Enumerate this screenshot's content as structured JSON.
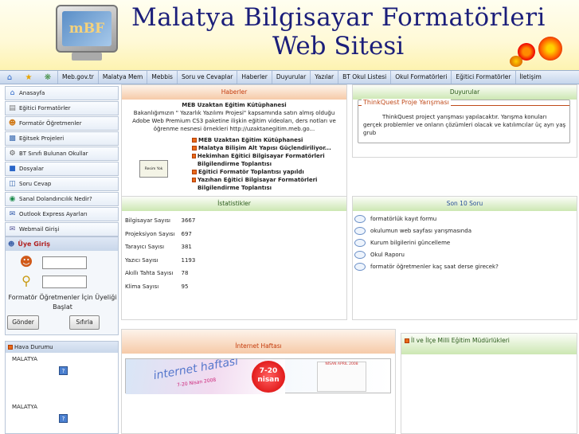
{
  "header": {
    "logo_text": "mBF",
    "title_line1": "Malatya Bilgisayar Formatörleri",
    "title_line2": "Web Sitesi"
  },
  "nav": {
    "icons": [
      "home-icon",
      "favorite-star-icon",
      "network-icon"
    ],
    "items": [
      "Meb.gov.tr",
      "Malatya Mem",
      "Mebbis",
      "Soru ve Cevaplar",
      "Haberler",
      "Duyurular",
      "Yazılar",
      "BT Okul Listesi",
      "Okul Formatörleri",
      "Eğitici Formatörler",
      "İletişim"
    ]
  },
  "sidebar": {
    "items": [
      {
        "label": "Anasayfa",
        "icon": "home-icon"
      },
      {
        "label": "Eğitici Formatörler",
        "icon": "document-icon"
      },
      {
        "label": "Formatör Öğretmenler",
        "icon": "users-icon"
      },
      {
        "label": "Eğitsek Projeleri",
        "icon": "clipboard-icon"
      },
      {
        "label": "BT Sınıfı Bulunan Okullar",
        "icon": "gear-icon"
      },
      {
        "label": "Dosyalar",
        "icon": "folder-icon"
      },
      {
        "label": "Soru Cevap",
        "icon": "question-icon"
      },
      {
        "label": "Sanal Dolandırıcılık Nedir?",
        "icon": "globe-icon"
      },
      {
        "label": "Outlook Express Ayarları",
        "icon": "mail-icon"
      },
      {
        "label": "Webmail Girişi",
        "icon": "webmail-icon"
      }
    ]
  },
  "login": {
    "title": "Üye Giriş",
    "username_value": "",
    "password_value": "",
    "note": "Formatör Öğretmenler İçin Üyeliği Başlat",
    "submit_label": "Gönder",
    "reset_label": "Sıfırla"
  },
  "weather": {
    "title": "Hava Durumu",
    "cities": [
      "MALATYA",
      "MALATYA"
    ]
  },
  "news": {
    "title": "Haberler",
    "headline": "MEB Uzaktan Eğitim Kütüphanesi",
    "body": "Bakanlığımızın \" Yazarlık Yazılımı Projesi\" kapsamında satın almış olduğu Adobe Web Premium CS3 paketine ilişkin eğitim videoları, ders notları ve öğrenme nesnesi örnekleri http://uzaktanegitim.meb.go...",
    "thumb_caption": "Resim Yok",
    "links": [
      "MEB Uzaktan Eğitim Kütüphanesi",
      "Malatya Bilişim Alt Yapısı Güçlendiriliyor...",
      "Hekimhan Eğitici Bilgisayar Formatörleri Bilgilendirme Toplantısı",
      "Eğitici Formatör Toplantısı yapıldı",
      "Yazıhan Eğitici Bilgisayar Formatörleri Bilgilendirme Toplantısı"
    ]
  },
  "announcements": {
    "title": "Duyurular",
    "box_title": "ThinkQuest Proje Yarışması",
    "box_text": "ThinkQuest project yarışması yapılacaktır. Yarışma konuları gerçek problemler ve onların çözümleri olacak ve katılımcılar üç ayrı yaş grub"
  },
  "stats": {
    "title": "İstatistikler",
    "rows": [
      {
        "label": "Bilgisayar Sayısı",
        "value": "3667"
      },
      {
        "label": "Projeksiyon Sayısı",
        "value": "697"
      },
      {
        "label": "Tarayıcı Sayısı",
        "value": "381"
      },
      {
        "label": "Yazıcı Sayısı",
        "value": "1193"
      },
      {
        "label": "Akıllı Tahta Sayısı",
        "value": "78"
      },
      {
        "label": "Klima Sayısı",
        "value": "95"
      }
    ]
  },
  "questions": {
    "title": "Son 10 Soru",
    "items": [
      "formatörlük kayıt formu",
      "okulumun web sayfası yarışmasında",
      "Kurum bilgilerini güncelleme",
      "Okul Raporu",
      "formatör öğretmenler kaç saat derse girecek?"
    ]
  },
  "internet_week": {
    "title": "İnternet Haftası",
    "banner_title": "internet haftası",
    "banner_date": "7-20 Nisan 2008",
    "banner_badge": "7-20 nisan",
    "calendar_title": "NİSAN APRIL 2008"
  },
  "directorates": {
    "title": "İl ve İlçe Milli Eğitim Müdürlükleri"
  },
  "colors": {
    "title_blue": "#1b1e7a",
    "accent_orange": "#c43a0a",
    "panel_green": "#cce7b2",
    "panel_orange": "#f6caa8"
  }
}
